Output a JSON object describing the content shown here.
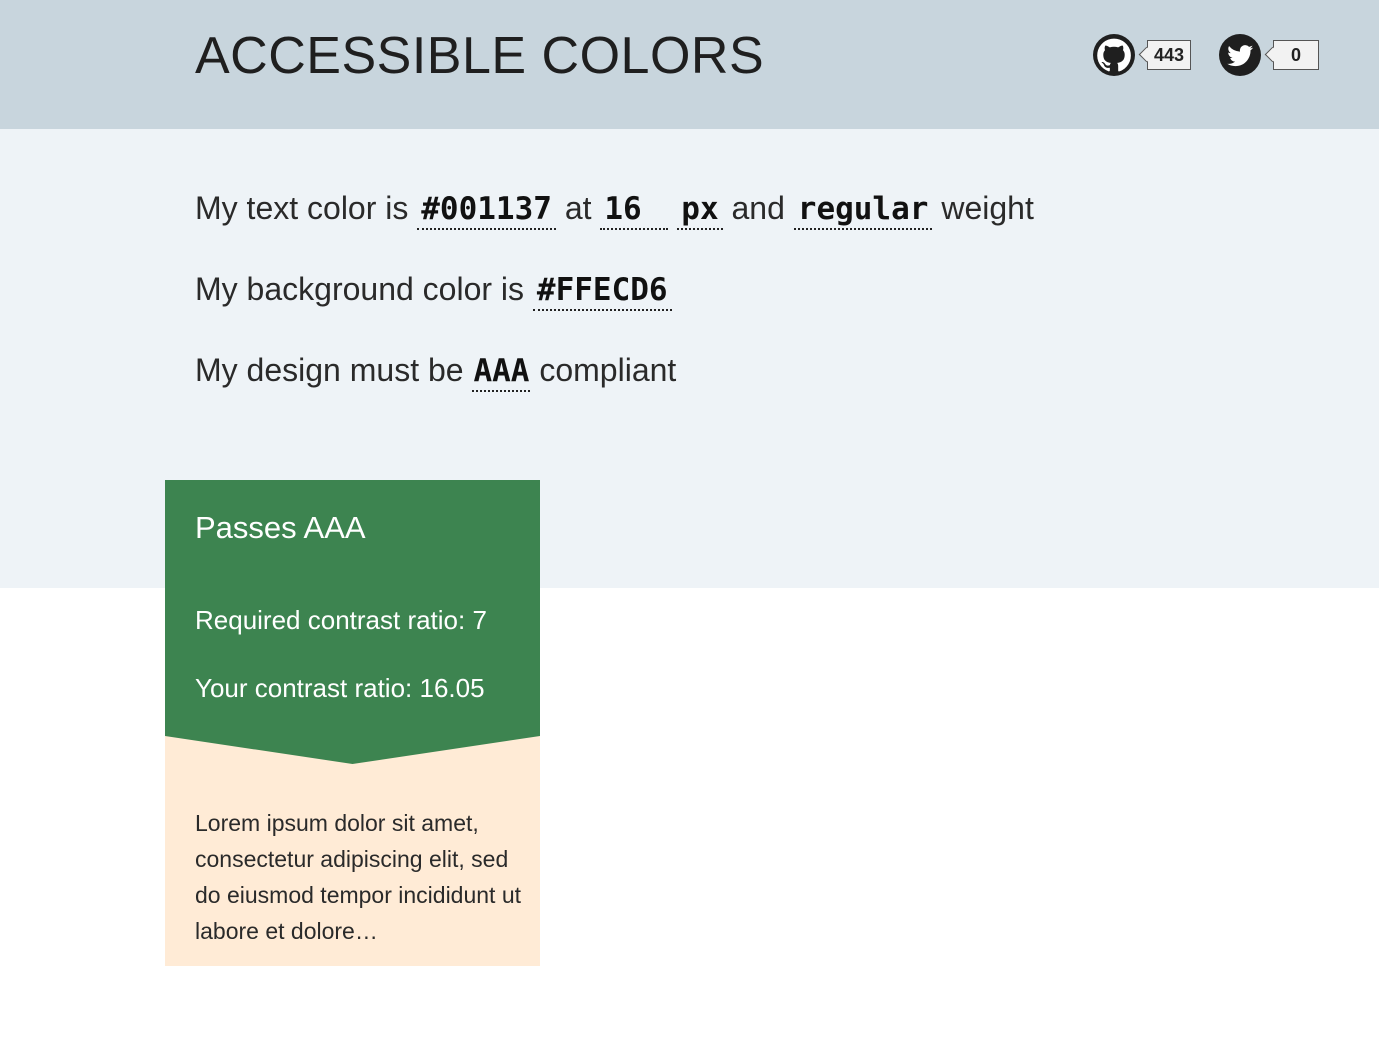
{
  "header": {
    "title": "ACCESSIBLE COLORS",
    "github": {
      "icon": "github-icon",
      "count": "443"
    },
    "twitter": {
      "icon": "twitter-icon",
      "count": "0"
    }
  },
  "form": {
    "line1": {
      "prefix": "My text color is",
      "text_color": "#001137",
      "at": "at",
      "font_size": "16",
      "unit": "px",
      "and": "and",
      "weight": "regular",
      "suffix": "weight"
    },
    "line2": {
      "prefix": "My background color is",
      "bg_color": "#FFECD6"
    },
    "line3": {
      "prefix": "My design must be",
      "level": "AAA",
      "suffix": "compliant"
    }
  },
  "result": {
    "verdict": "Passes AAA",
    "required_ratio": "Required contrast ratio: 7",
    "your_ratio": "Your contrast ratio: 16.05",
    "sample_text": "Lorem ipsum dolor sit amet, consectetur adipiscing elit, sed do eiusmod tempor incididunt ut labore et dolore…"
  },
  "colors": {
    "header_bg": "#c8d5dd",
    "panel_bg": "#eef3f7",
    "pass_green": "#3d8450",
    "sample_bg": "#ffebd6"
  }
}
